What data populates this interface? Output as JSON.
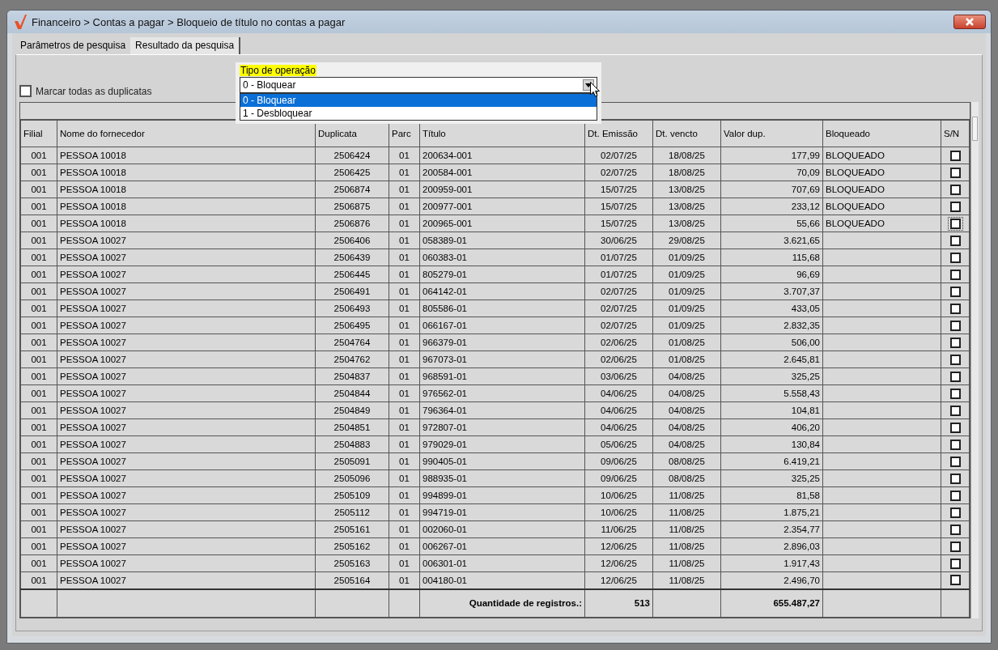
{
  "window": {
    "title": "Financeiro > Contas a pagar > Bloqueio de título no contas a pagar"
  },
  "tabs": [
    {
      "label": "Parâmetros de pesquisa",
      "selected": false
    },
    {
      "label": "Resultado da pesquisa",
      "selected": true
    }
  ],
  "mark_all": {
    "label": "Marcar todas as duplicatas",
    "checked": false
  },
  "operation": {
    "label": "Tipo de operação",
    "value": "0 - Bloquear",
    "options": [
      {
        "label": "0 - Bloquear",
        "selected": true
      },
      {
        "label": "1 - Desbloquear",
        "selected": false
      }
    ]
  },
  "table": {
    "columns": [
      "Filial",
      "Nome do fornecedor",
      "Duplicata",
      "Parc",
      "Título",
      "Dt. Emissão",
      "Dt. vencto",
      "Valor dup.",
      "Bloqueado",
      "S/N"
    ],
    "rows": [
      {
        "cells": [
          "001",
          "PESSOA 10018",
          "2506424",
          "01",
          "200634-001",
          "02/07/25",
          "18/08/25",
          "177,99",
          "BLOQUEADO"
        ],
        "checked": false,
        "focused": false
      },
      {
        "cells": [
          "001",
          "PESSOA 10018",
          "2506425",
          "01",
          "200584-001",
          "02/07/25",
          "18/08/25",
          "70,09",
          "BLOQUEADO"
        ],
        "checked": false,
        "focused": false
      },
      {
        "cells": [
          "001",
          "PESSOA 10018",
          "2506874",
          "01",
          "200959-001",
          "15/07/25",
          "13/08/25",
          "707,69",
          "BLOQUEADO"
        ],
        "checked": false,
        "focused": false
      },
      {
        "cells": [
          "001",
          "PESSOA 10018",
          "2506875",
          "01",
          "200977-001",
          "15/07/25",
          "13/08/25",
          "233,12",
          "BLOQUEADO"
        ],
        "checked": false,
        "focused": false
      },
      {
        "cells": [
          "001",
          "PESSOA 10018",
          "2506876",
          "01",
          "200965-001",
          "15/07/25",
          "13/08/25",
          "55,66",
          "BLOQUEADO"
        ],
        "checked": false,
        "focused": true
      },
      {
        "cells": [
          "001",
          "PESSOA 10027",
          "2506406",
          "01",
          "058389-01",
          "30/06/25",
          "29/08/25",
          "3.621,65",
          ""
        ],
        "checked": false,
        "focused": false
      },
      {
        "cells": [
          "001",
          "PESSOA 10027",
          "2506439",
          "01",
          "060383-01",
          "01/07/25",
          "01/09/25",
          "115,68",
          ""
        ],
        "checked": false,
        "focused": false
      },
      {
        "cells": [
          "001",
          "PESSOA 10027",
          "2506445",
          "01",
          "805279-01",
          "01/07/25",
          "01/09/25",
          "96,69",
          ""
        ],
        "checked": false,
        "focused": false
      },
      {
        "cells": [
          "001",
          "PESSOA 10027",
          "2506491",
          "01",
          "064142-01",
          "02/07/25",
          "01/09/25",
          "3.707,37",
          ""
        ],
        "checked": false,
        "focused": false
      },
      {
        "cells": [
          "001",
          "PESSOA 10027",
          "2506493",
          "01",
          "805586-01",
          "02/07/25",
          "01/09/25",
          "433,05",
          ""
        ],
        "checked": false,
        "focused": false
      },
      {
        "cells": [
          "001",
          "PESSOA 10027",
          "2506495",
          "01",
          "066167-01",
          "02/07/25",
          "01/09/25",
          "2.832,35",
          ""
        ],
        "checked": false,
        "focused": false
      },
      {
        "cells": [
          "001",
          "PESSOA 10027",
          "2504764",
          "01",
          "966379-01",
          "02/06/25",
          "01/08/25",
          "506,00",
          ""
        ],
        "checked": false,
        "focused": false
      },
      {
        "cells": [
          "001",
          "PESSOA 10027",
          "2504762",
          "01",
          "967073-01",
          "02/06/25",
          "01/08/25",
          "2.645,81",
          ""
        ],
        "checked": false,
        "focused": false
      },
      {
        "cells": [
          "001",
          "PESSOA 10027",
          "2504837",
          "01",
          "968591-01",
          "03/06/25",
          "04/08/25",
          "325,25",
          ""
        ],
        "checked": false,
        "focused": false
      },
      {
        "cells": [
          "001",
          "PESSOA 10027",
          "2504844",
          "01",
          "976562-01",
          "04/06/25",
          "04/08/25",
          "5.558,43",
          ""
        ],
        "checked": false,
        "focused": false
      },
      {
        "cells": [
          "001",
          "PESSOA 10027",
          "2504849",
          "01",
          "796364-01",
          "04/06/25",
          "04/08/25",
          "104,81",
          ""
        ],
        "checked": false,
        "focused": false
      },
      {
        "cells": [
          "001",
          "PESSOA 10027",
          "2504851",
          "01",
          "972807-01",
          "04/06/25",
          "04/08/25",
          "406,20",
          ""
        ],
        "checked": false,
        "focused": false
      },
      {
        "cells": [
          "001",
          "PESSOA 10027",
          "2504883",
          "01",
          "979029-01",
          "05/06/25",
          "04/08/25",
          "130,84",
          ""
        ],
        "checked": false,
        "focused": false
      },
      {
        "cells": [
          "001",
          "PESSOA 10027",
          "2505091",
          "01",
          "990405-01",
          "09/06/25",
          "08/08/25",
          "6.419,21",
          ""
        ],
        "checked": false,
        "focused": false
      },
      {
        "cells": [
          "001",
          "PESSOA 10027",
          "2505096",
          "01",
          "988935-01",
          "09/06/25",
          "08/08/25",
          "325,25",
          ""
        ],
        "checked": false,
        "focused": false
      },
      {
        "cells": [
          "001",
          "PESSOA 10027",
          "2505109",
          "01",
          "994899-01",
          "10/06/25",
          "11/08/25",
          "81,58",
          ""
        ],
        "checked": false,
        "focused": false
      },
      {
        "cells": [
          "001",
          "PESSOA 10027",
          "2505112",
          "01",
          "994719-01",
          "10/06/25",
          "11/08/25",
          "1.875,21",
          ""
        ],
        "checked": false,
        "focused": false
      },
      {
        "cells": [
          "001",
          "PESSOA 10027",
          "2505161",
          "01",
          "002060-01",
          "11/06/25",
          "11/08/25",
          "2.354,77",
          ""
        ],
        "checked": false,
        "focused": false
      },
      {
        "cells": [
          "001",
          "PESSOA 10027",
          "2505162",
          "01",
          "006267-01",
          "12/06/25",
          "11/08/25",
          "2.896,03",
          ""
        ],
        "checked": false,
        "focused": false
      },
      {
        "cells": [
          "001",
          "PESSOA 10027",
          "2505163",
          "01",
          "006301-01",
          "12/06/25",
          "11/08/25",
          "1.917,43",
          ""
        ],
        "checked": false,
        "focused": false
      },
      {
        "cells": [
          "001",
          "PESSOA 10027",
          "2505164",
          "01",
          "004180-01",
          "12/06/25",
          "11/08/25",
          "2.496,70",
          ""
        ],
        "checked": false,
        "focused": false
      }
    ],
    "footer": {
      "label": "Quantidade de registros.:",
      "count": "513",
      "total": "655.487,27"
    }
  }
}
